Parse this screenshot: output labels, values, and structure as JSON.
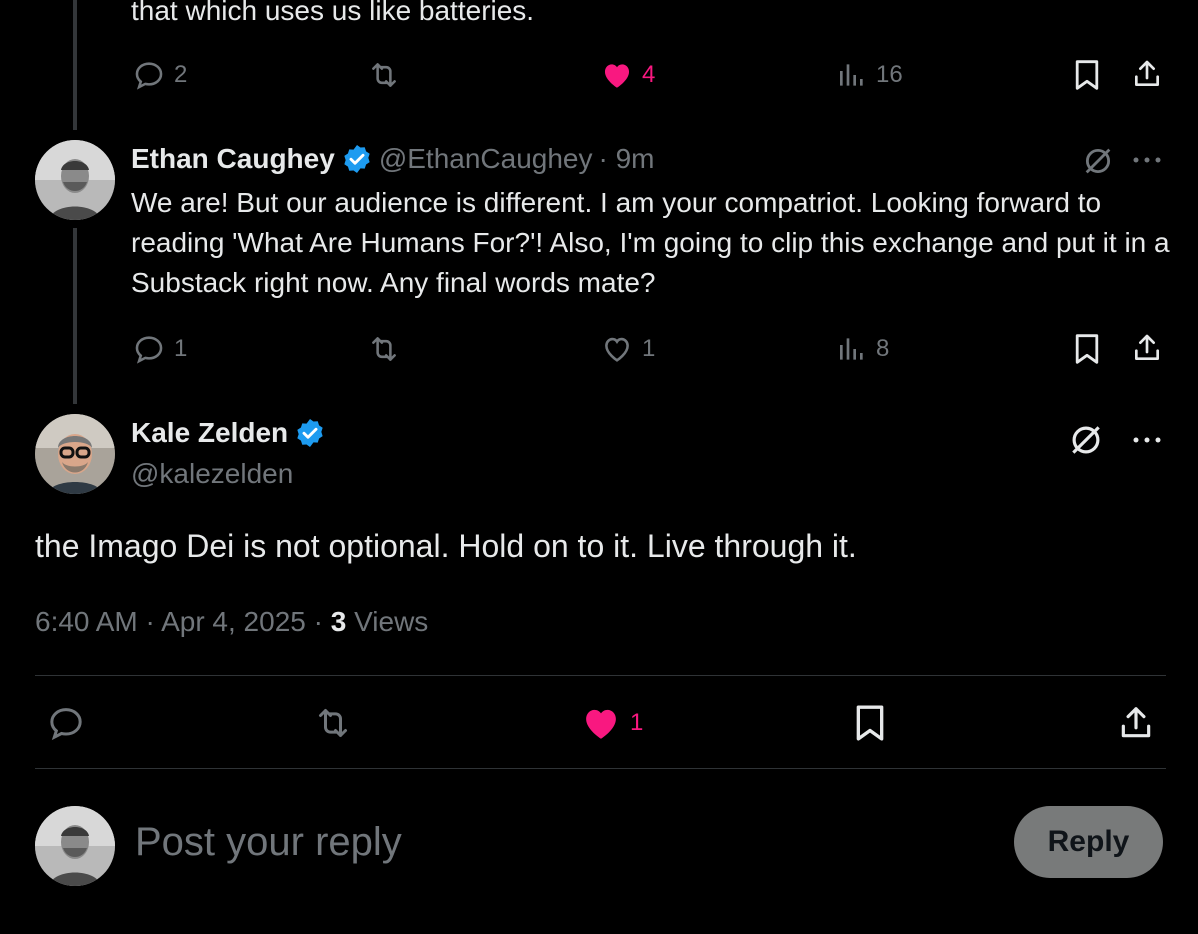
{
  "tweet1": {
    "text_tail": "that which uses us like batteries.",
    "replies": "2",
    "likes": "4",
    "views": "16"
  },
  "tweet2": {
    "name": "Ethan Caughey",
    "handle": "@EthanCaughey",
    "time": "· 9m",
    "text": "We are! But our audience is different. I am your compatriot. Looking forward to reading 'What Are Humans For?'! Also, I'm going to clip this exchange and put it in a Substack right now. Any final words mate?",
    "replies": "1",
    "likes": "1",
    "views": "8"
  },
  "main": {
    "name": "Kale Zelden",
    "handle": "@kalezelden",
    "text": "the Imago Dei is not optional. Hold on to it. Live through it.",
    "time": "6:40 AM",
    "date": "Apr 4, 2025",
    "views_count": "3",
    "views_label": "Views",
    "likes": "1"
  },
  "reply_box": {
    "placeholder": "Post your reply",
    "button": "Reply"
  },
  "colors": {
    "like_pink": "#f91880",
    "verified_blue": "#1d9bf0",
    "muted": "#71767b"
  }
}
